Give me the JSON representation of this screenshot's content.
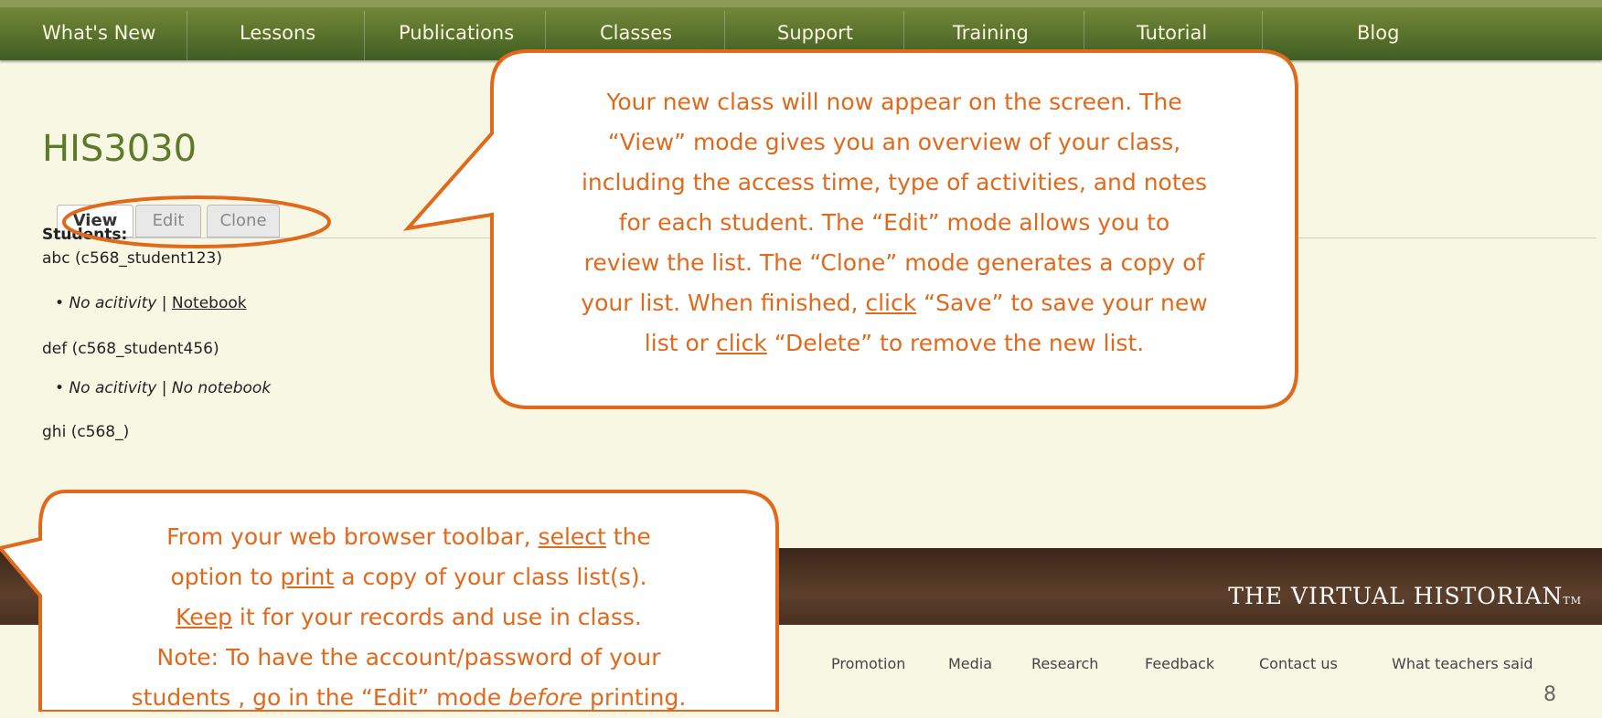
{
  "nav": {
    "items": [
      "What's New",
      "Lessons",
      "Publications",
      "Classes",
      "Support",
      "Training",
      "Tutorial",
      "Blog"
    ]
  },
  "page_title": "HIS3030",
  "tabs": [
    "View",
    "Edit",
    "Clone"
  ],
  "students_label": "Students:",
  "students": [
    {
      "name": "abc (c568_student123)",
      "activity": "No acitivity",
      "separator": "|",
      "notebook": "Notebook"
    },
    {
      "name": "def (c568_student456)",
      "activity": "No acitivity",
      "separator": "|",
      "notebook": "No notebook"
    },
    {
      "name": "ghi (c568_)"
    }
  ],
  "callout_top": {
    "line1": "Your new class will now appear on the screen. The",
    "line2": "“View” mode gives you an overview of your class,",
    "line3": "including the access time, type of activities, and notes",
    "line4": "for each student. The “Edit” mode allows you to",
    "line5": "review the list. The “Clone” mode generates a copy of",
    "line6_a": "your list. When finished, ",
    "line6_link": "click",
    "line6_b": " “Save” to save your new",
    "line7_a": "list or ",
    "line7_link": "click",
    "line7_b": " “Delete” to remove the new list."
  },
  "callout_bottom": {
    "line1_a": "From your web browser toolbar, ",
    "line1_link": "select",
    "line1_b": " the",
    "line2_a": "option to ",
    "line2_link": "print",
    "line2_b": " a copy of your class list(s).",
    "line3_link": "Keep",
    "line3_b": " it for your records and use in class.",
    "line4": "Note: To have the account/password of your",
    "line5_a": "students , go in the “Edit” mode ",
    "line5_em": "before",
    "line5_b": " printing."
  },
  "footer": {
    "brand": "THE VIRTUAL HISTORIAN",
    "tm": "TM",
    "links": [
      "Promotion",
      "Media",
      "Research",
      "Feedback",
      "Contact us",
      "What teachers said"
    ]
  },
  "page_number": "8",
  "colors": {
    "accent": "#e1691c",
    "nav": "#4a6628",
    "title": "#5d7a2b",
    "footer": "#4a3022"
  }
}
